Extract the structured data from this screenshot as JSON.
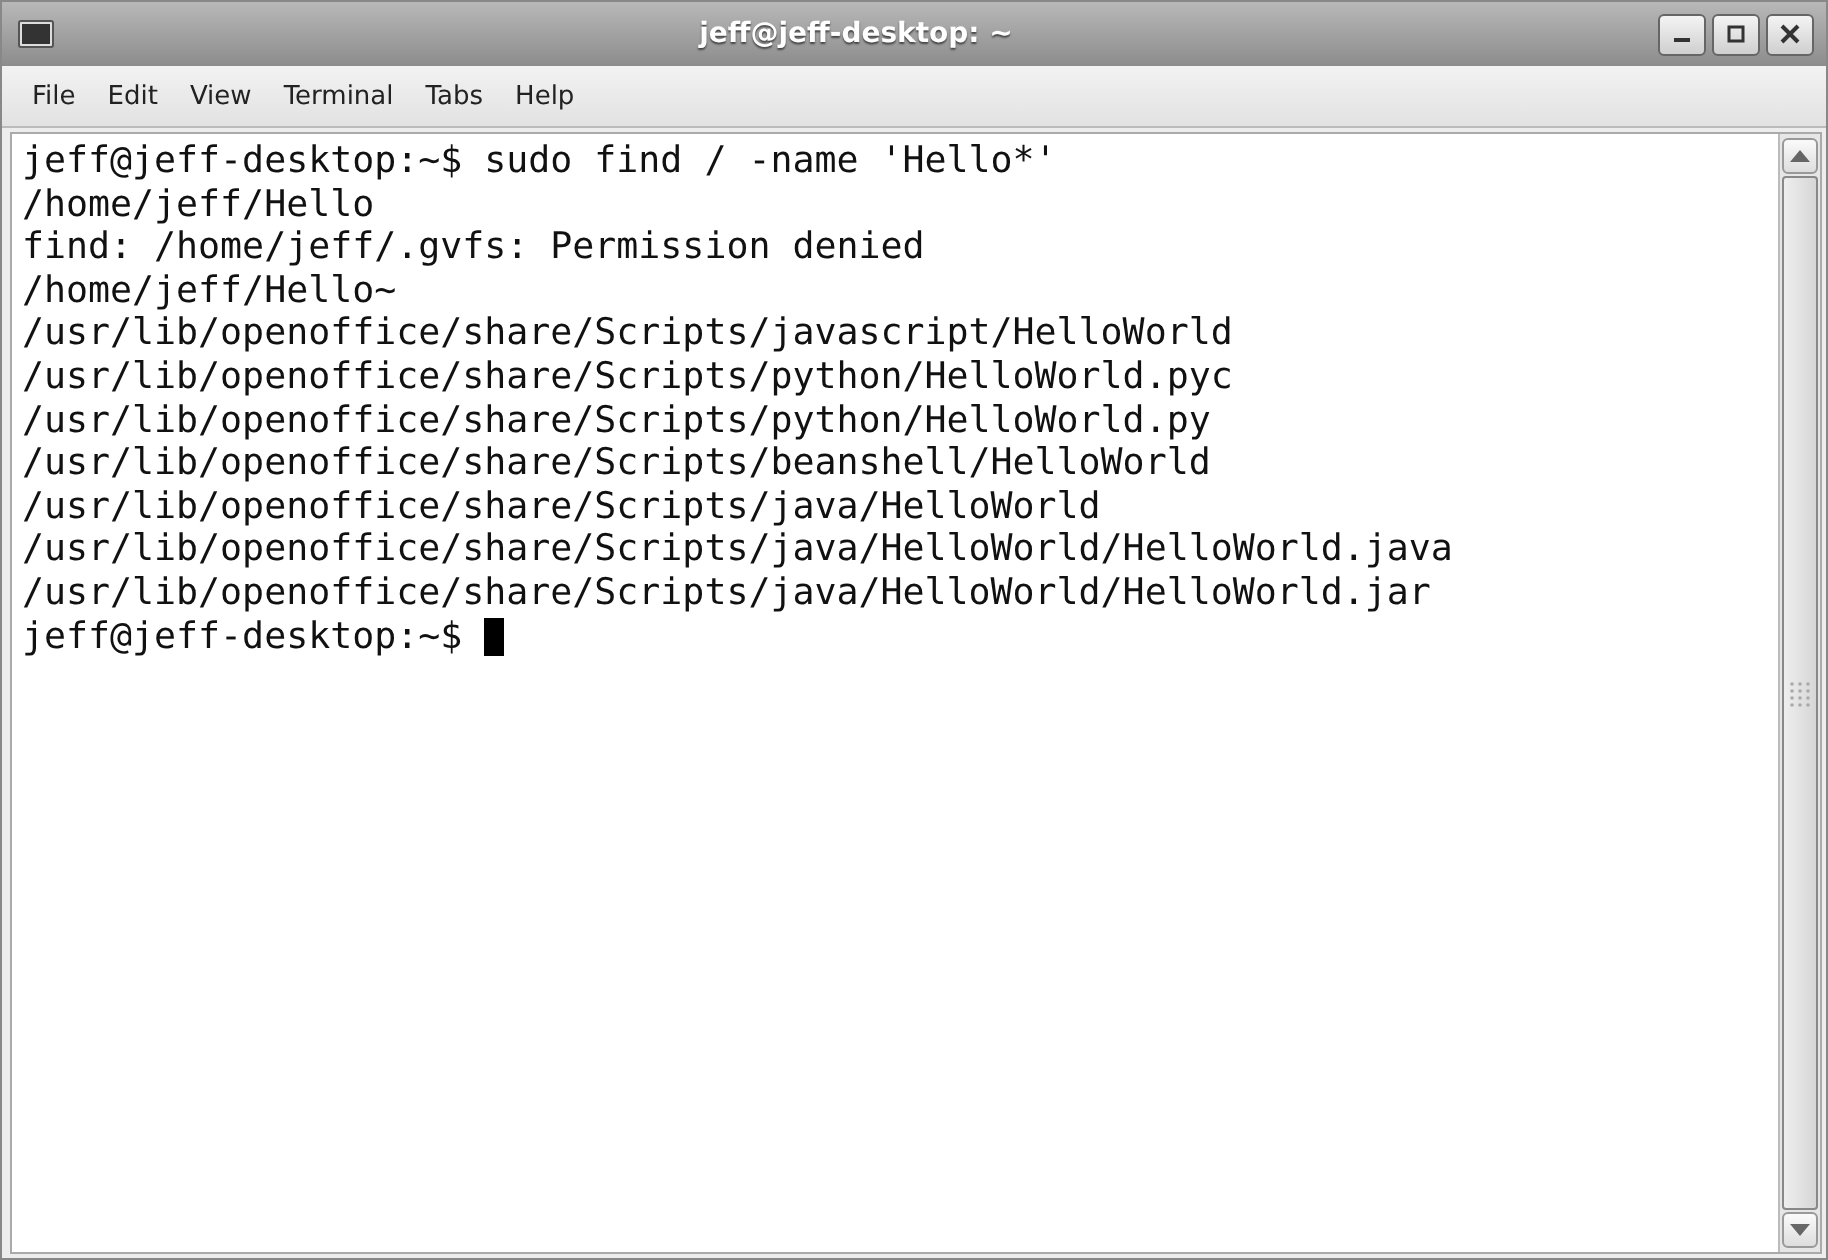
{
  "window": {
    "title": "jeff@jeff-desktop: ~"
  },
  "menu": [
    "File",
    "Edit",
    "View",
    "Terminal",
    "Tabs",
    "Help"
  ],
  "terminal": {
    "lines": [
      {
        "text": "jeff@jeff-desktop:~$ sudo find / -name 'Hello*'",
        "cursor": false
      },
      {
        "text": "/home/jeff/Hello",
        "cursor": false
      },
      {
        "text": "find: /home/jeff/.gvfs: Permission denied",
        "cursor": false
      },
      {
        "text": "/home/jeff/Hello~",
        "cursor": false
      },
      {
        "text": "/usr/lib/openoffice/share/Scripts/javascript/HelloWorld",
        "cursor": false
      },
      {
        "text": "/usr/lib/openoffice/share/Scripts/python/HelloWorld.pyc",
        "cursor": false
      },
      {
        "text": "/usr/lib/openoffice/share/Scripts/python/HelloWorld.py",
        "cursor": false
      },
      {
        "text": "/usr/lib/openoffice/share/Scripts/beanshell/HelloWorld",
        "cursor": false
      },
      {
        "text": "/usr/lib/openoffice/share/Scripts/java/HelloWorld",
        "cursor": false
      },
      {
        "text": "/usr/lib/openoffice/share/Scripts/java/HelloWorld/HelloWorld.java",
        "cursor": false
      },
      {
        "text": "/usr/lib/openoffice/share/Scripts/java/HelloWorld/HelloWorld.jar",
        "cursor": false
      },
      {
        "text": "jeff@jeff-desktop:~$ ",
        "cursor": true
      }
    ]
  }
}
